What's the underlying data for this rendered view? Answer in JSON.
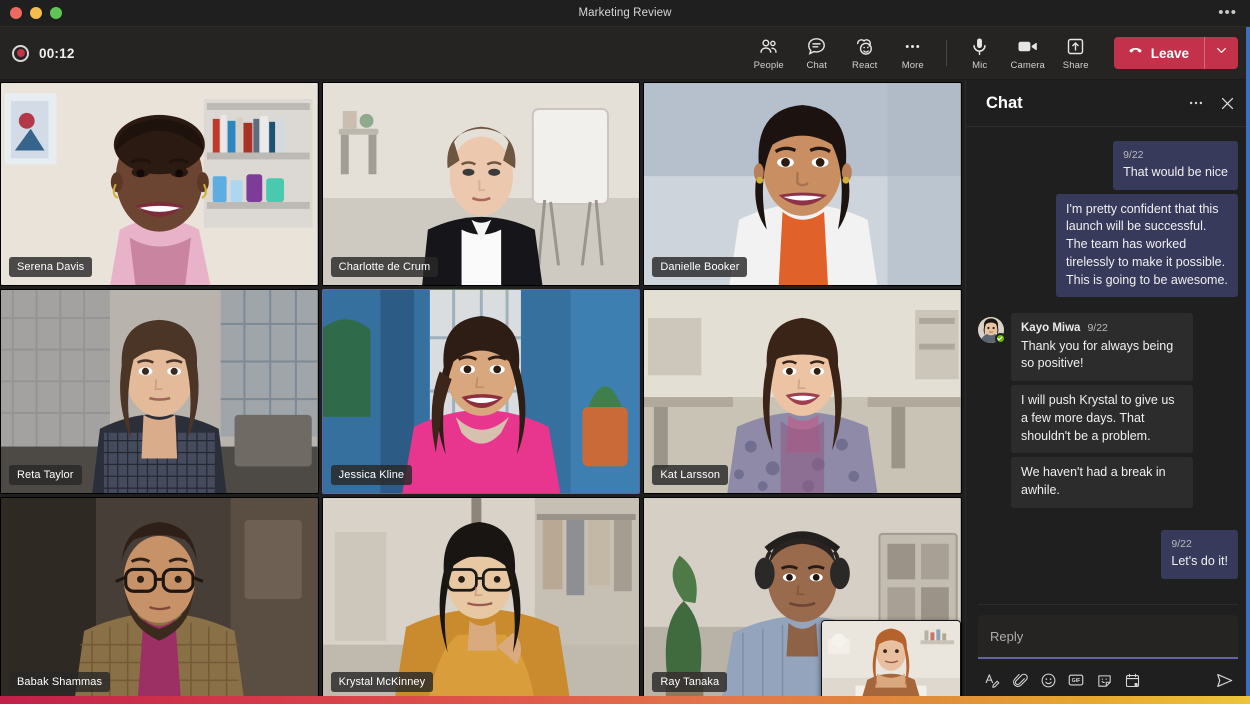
{
  "window": {
    "title": "Marketing Review",
    "more_icon": "ellipsis-icon",
    "traffic_lights": [
      "close",
      "minimize",
      "maximize"
    ]
  },
  "toolbar": {
    "recording_time": "00:12",
    "buttons": [
      {
        "label": "People",
        "icon": "people-icon"
      },
      {
        "label": "Chat",
        "icon": "chat-icon"
      },
      {
        "label": "React",
        "icon": "react-icon"
      },
      {
        "label": "More",
        "icon": "ellipsis-icon"
      },
      {
        "label": "Mic",
        "icon": "mic-icon"
      },
      {
        "label": "Camera",
        "icon": "camera-icon"
      },
      {
        "label": "Share",
        "icon": "share-icon"
      }
    ],
    "leave": {
      "label": "Leave",
      "color": "#c4314b",
      "caret_icon": "chevron-down-icon"
    }
  },
  "stage": {
    "participants": [
      {
        "name": "Serena Davis",
        "active": false
      },
      {
        "name": "Charlotte de Crum",
        "active": false
      },
      {
        "name": "Danielle Booker",
        "active": false
      },
      {
        "name": "Reta Taylor",
        "active": false
      },
      {
        "name": "Jessica Kline",
        "active": true
      },
      {
        "name": "Kat Larsson",
        "active": false
      },
      {
        "name": "Babak Shammas",
        "active": false
      },
      {
        "name": "Krystal McKinney",
        "active": false
      },
      {
        "name": "Ray Tanaka",
        "active": false
      }
    ],
    "self_view_label": "self-view"
  },
  "chat": {
    "title": "Chat",
    "more_icon": "ellipsis-icon",
    "close_icon": "close-icon",
    "messages": [
      {
        "direction": "out",
        "timestamp": "9/22",
        "text": "That would be nice"
      },
      {
        "direction": "out",
        "text": "I'm pretty confident that this launch will be successful. The team has worked tirelessly to make it possible. This is going to be awesome."
      },
      {
        "direction": "in",
        "sender": "Kayo Miwa",
        "timestamp": "9/22",
        "avatar": true,
        "presence": "available",
        "text": "Thank you for always being so positive!"
      },
      {
        "direction": "in",
        "text": "I will push Krystal to give us a few more days. That shouldn't be a problem."
      },
      {
        "direction": "in",
        "text": "We haven't had a break in awhile."
      },
      {
        "direction": "out",
        "timestamp": "9/22",
        "text": "Let's do it!"
      }
    ],
    "compose": {
      "placeholder": "Reply",
      "value": "",
      "actions": [
        {
          "name": "format-icon"
        },
        {
          "name": "attach-icon"
        },
        {
          "name": "emoji-icon"
        },
        {
          "name": "gif-icon"
        },
        {
          "name": "sticker-icon"
        },
        {
          "name": "meeting-icon"
        }
      ],
      "send_icon": "send-icon"
    }
  },
  "colors": {
    "accent": "#6264a7",
    "leave": "#c4314b",
    "presence_available": "#6bb700",
    "edge_blue": "#3b6fc4"
  }
}
